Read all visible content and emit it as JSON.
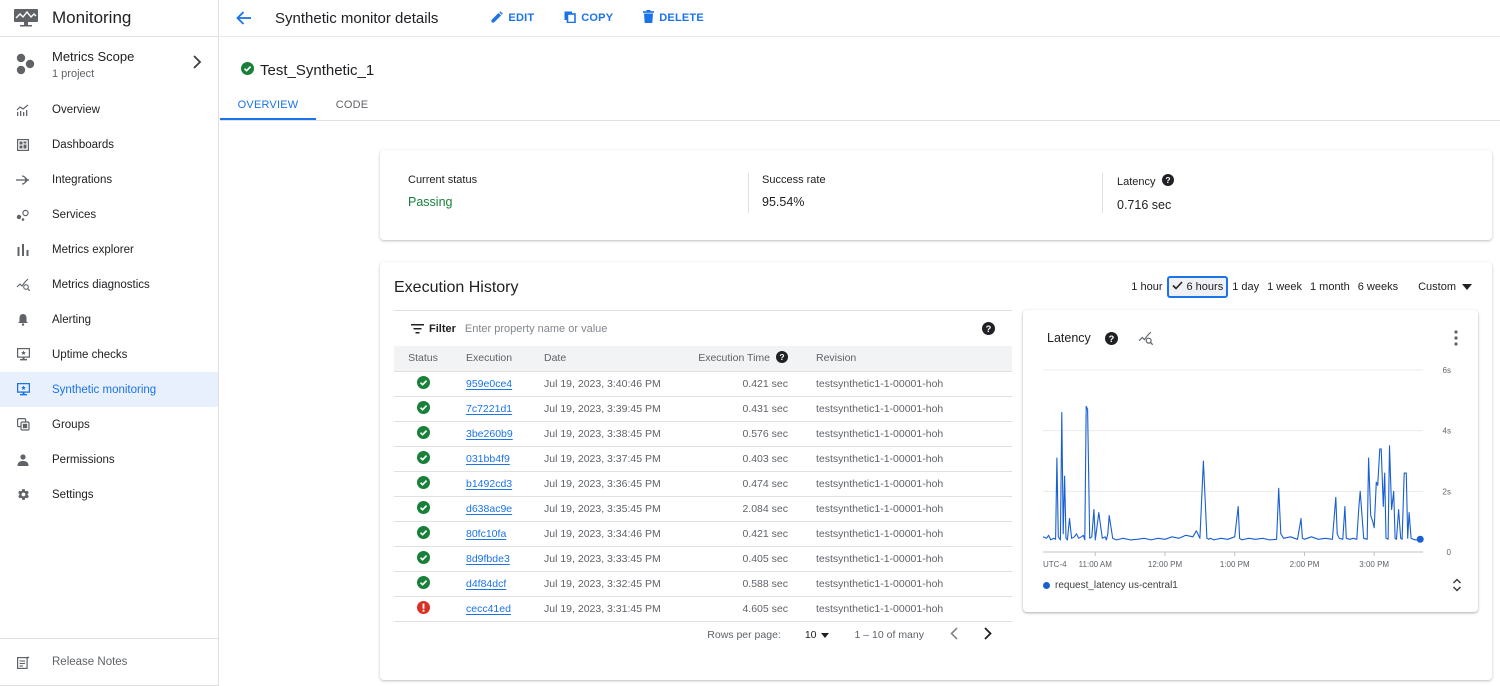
{
  "sidebar": {
    "product_title": "Monitoring",
    "scope": {
      "title": "Metrics Scope",
      "subtitle": "1 project"
    },
    "items": [
      {
        "label": "Overview",
        "icon": "overview-icon"
      },
      {
        "label": "Dashboards",
        "icon": "dashboards-icon"
      },
      {
        "label": "Integrations",
        "icon": "integrations-icon"
      },
      {
        "label": "Services",
        "icon": "services-icon"
      },
      {
        "label": "Metrics explorer",
        "icon": "metrics-explorer-icon"
      },
      {
        "label": "Metrics diagnostics",
        "icon": "metrics-diagnostics-icon"
      },
      {
        "label": "Alerting",
        "icon": "bell-icon"
      },
      {
        "label": "Uptime checks",
        "icon": "uptime-monitor-icon"
      },
      {
        "label": "Synthetic monitoring",
        "icon": "synthetic-monitor-icon",
        "active": true
      },
      {
        "label": "Groups",
        "icon": "groups-icon"
      },
      {
        "label": "Permissions",
        "icon": "person-icon"
      },
      {
        "label": "Settings",
        "icon": "gear-icon"
      }
    ],
    "footer": {
      "label": "Release Notes"
    }
  },
  "topbar": {
    "title": "Synthetic monitor details",
    "edit_label": "EDIT",
    "copy_label": "COPY",
    "delete_label": "DELETE"
  },
  "resource": {
    "name": "Test_Synthetic_1",
    "status_icon": "check-circle-icon"
  },
  "tabs": [
    {
      "label": "OVERVIEW",
      "active": true
    },
    {
      "label": "CODE",
      "active": false
    }
  ],
  "summary": {
    "current_status": {
      "label": "Current status",
      "value": "Passing"
    },
    "success_rate": {
      "label": "Success rate",
      "value": "95.54%"
    },
    "latency": {
      "label": "Latency",
      "value": "0.716 sec"
    }
  },
  "history": {
    "title": "Execution History",
    "time_ranges": [
      "1 hour",
      "6 hours",
      "1 day",
      "1 week",
      "1 month",
      "6 weeks"
    ],
    "selected_range": "6 hours",
    "custom_label": "Custom",
    "filter": {
      "label": "Filter",
      "placeholder": "Enter property name or value",
      "value": ""
    },
    "columns": [
      "Status",
      "Execution",
      "Date",
      "Execution Time",
      "Revision"
    ],
    "rows": [
      {
        "status": "success",
        "execution": "959e0ce4",
        "date": "Jul 19, 2023, 3:40:46 PM",
        "time": "0.421 sec",
        "revision": "testsynthetic1-1-00001-hoh"
      },
      {
        "status": "success",
        "execution": "7c7221d1",
        "date": "Jul 19, 2023, 3:39:45 PM",
        "time": "0.431 sec",
        "revision": "testsynthetic1-1-00001-hoh"
      },
      {
        "status": "success",
        "execution": "3be260b9",
        "date": "Jul 19, 2023, 3:38:45 PM",
        "time": "0.576 sec",
        "revision": "testsynthetic1-1-00001-hoh"
      },
      {
        "status": "success",
        "execution": "031bb4f9",
        "date": "Jul 19, 2023, 3:37:45 PM",
        "time": "0.403 sec",
        "revision": "testsynthetic1-1-00001-hoh"
      },
      {
        "status": "success",
        "execution": "b1492cd3",
        "date": "Jul 19, 2023, 3:36:45 PM",
        "time": "0.474 sec",
        "revision": "testsynthetic1-1-00001-hoh"
      },
      {
        "status": "success",
        "execution": "d638ac9e",
        "date": "Jul 19, 2023, 3:35:45 PM",
        "time": "2.084 sec",
        "revision": "testsynthetic1-1-00001-hoh"
      },
      {
        "status": "success",
        "execution": "80fc10fa",
        "date": "Jul 19, 2023, 3:34:46 PM",
        "time": "0.421 sec",
        "revision": "testsynthetic1-1-00001-hoh"
      },
      {
        "status": "success",
        "execution": "8d9fbde3",
        "date": "Jul 19, 2023, 3:33:45 PM",
        "time": "0.405 sec",
        "revision": "testsynthetic1-1-00001-hoh"
      },
      {
        "status": "success",
        "execution": "d4f84dcf",
        "date": "Jul 19, 2023, 3:32:45 PM",
        "time": "0.588 sec",
        "revision": "testsynthetic1-1-00001-hoh"
      },
      {
        "status": "error",
        "execution": "cecc41ed",
        "date": "Jul 19, 2023, 3:31:45 PM",
        "time": "4.605 sec",
        "revision": "testsynthetic1-1-00001-hoh"
      }
    ],
    "pagination": {
      "rows_per_page_label": "Rows per page:",
      "rows_per_page": "10",
      "range_text": "1 – 10 of many"
    }
  },
  "colors": {
    "accent": "#1a73e8",
    "success": "#188038",
    "error": "#d93025",
    "series": "#1a5fd1"
  },
  "chart_data": {
    "type": "line",
    "title": "Latency",
    "ylabel": "",
    "xlabel": "",
    "timezone_label": "UTC-4",
    "x_ticks": [
      "11:00 AM",
      "12:00 PM",
      "1:00 PM",
      "2:00 PM",
      "3:00 PM"
    ],
    "x_range_hours": [
      10.25,
      15.7
    ],
    "y_ticks": [
      "0",
      "2s",
      "4s",
      "6s"
    ],
    "ylim": [
      0,
      6
    ],
    "grid": true,
    "legend": "bottom-left",
    "series": [
      {
        "name": "request_latency us-central1",
        "x_hours": [
          10.25,
          10.3,
          10.33,
          10.36,
          10.4,
          10.43,
          10.45,
          10.47,
          10.5,
          10.52,
          10.54,
          10.56,
          10.58,
          10.6,
          10.63,
          10.66,
          10.7,
          10.73,
          10.76,
          10.8,
          10.83,
          10.85,
          10.87,
          10.89,
          10.92,
          10.95,
          10.98,
          11.0,
          11.05,
          11.1,
          11.14,
          11.16,
          11.18,
          11.2,
          11.25,
          11.3,
          11.4,
          11.5,
          11.6,
          11.7,
          11.8,
          11.9,
          12.0,
          12.1,
          12.2,
          12.3,
          12.4,
          12.45,
          12.5,
          12.55,
          12.6,
          12.63,
          12.65,
          12.7,
          12.8,
          12.9,
          13.0,
          13.05,
          13.07,
          13.1,
          13.2,
          13.3,
          13.4,
          13.5,
          13.6,
          13.63,
          13.66,
          13.7,
          13.8,
          13.9,
          13.95,
          13.97,
          14.0,
          14.1,
          14.2,
          14.3,
          14.4,
          14.45,
          14.47,
          14.5,
          14.55,
          14.58,
          14.6,
          14.65,
          14.7,
          14.75,
          14.78,
          14.8,
          14.85,
          14.9,
          14.92,
          14.95,
          14.98,
          15.0,
          15.03,
          15.05,
          15.08,
          15.1,
          15.13,
          15.15,
          15.17,
          15.2,
          15.22,
          15.25,
          15.28,
          15.3,
          15.32,
          15.35,
          15.38,
          15.4,
          15.43,
          15.46,
          15.48,
          15.5,
          15.53,
          15.56,
          15.6,
          15.63,
          15.66
        ],
        "values": [
          0.5,
          0.45,
          0.55,
          0.4,
          0.45,
          0.42,
          3.1,
          0.5,
          0.4,
          4.6,
          0.6,
          2.5,
          0.45,
          0.4,
          1.1,
          0.45,
          0.5,
          0.6,
          0.45,
          0.5,
          0.55,
          0.4,
          4.8,
          4.7,
          0.45,
          0.5,
          1.4,
          0.4,
          1.3,
          0.45,
          0.5,
          0.4,
          0.6,
          1.2,
          0.45,
          0.4,
          0.45,
          0.4,
          0.42,
          0.45,
          0.4,
          0.45,
          0.42,
          0.5,
          0.45,
          0.55,
          0.5,
          0.7,
          0.45,
          3.0,
          0.45,
          0.42,
          0.45,
          0.4,
          0.45,
          0.42,
          0.5,
          1.5,
          0.45,
          0.4,
          0.45,
          0.42,
          0.45,
          0.4,
          0.42,
          2.1,
          0.6,
          0.45,
          0.5,
          0.42,
          1.1,
          0.45,
          0.42,
          0.5,
          0.42,
          0.45,
          0.42,
          1.8,
          0.6,
          0.45,
          0.42,
          1.5,
          0.45,
          0.42,
          0.45,
          0.42,
          1.5,
          2.0,
          0.45,
          0.42,
          3.1,
          1.2,
          1.0,
          0.8,
          2.3,
          2.2,
          3.4,
          3.4,
          1.5,
          2.6,
          0.45,
          0.42,
          3.5,
          1.4,
          2.0,
          0.45,
          0.42,
          1.4,
          0.45,
          0.42,
          2.6,
          2.6,
          0.45,
          1.3,
          0.45,
          0.42,
          0.4,
          0.4,
          0.42
        ]
      }
    ]
  }
}
